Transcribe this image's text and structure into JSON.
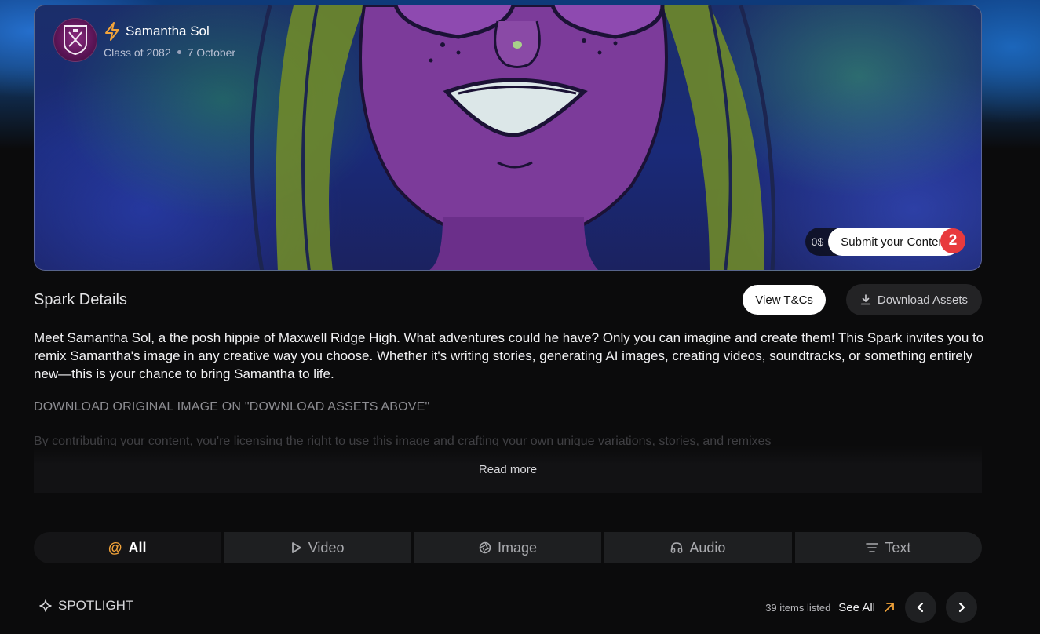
{
  "creator": {
    "name": "Samantha Sol",
    "class": "Class of 2082",
    "date": "7 October",
    "avatar_icon": "school-crest-icon"
  },
  "hero": {
    "price": "0$",
    "submit_label": "Submit your Content",
    "badge_count": "2"
  },
  "details": {
    "title": "Spark Details",
    "view_tcs_label": "View T&Cs",
    "download_assets_label": "Download Assets",
    "description": "Meet Samantha Sol, a the posh hippie of Maxwell Ridge High. What adventures could he have? Only you can imagine and create them! This Spark invites you to remix Samantha's image in any creative way you choose. Whether it's writing stories, generating AI images, creating videos, soundtracks, or something entirely new—this is your chance to bring Samantha to life.",
    "download_note": "DOWNLOAD ORIGINAL IMAGE ON \"DOWNLOAD ASSETS ABOVE\"",
    "faded_line": "By contributing your content, you're licensing the right to use this image and crafting your own unique variations, stories, and remixes",
    "read_more_label": "Read more"
  },
  "tabs": [
    {
      "label": "All",
      "icon": "at-icon"
    },
    {
      "label": "Video",
      "icon": "play-icon"
    },
    {
      "label": "Image",
      "icon": "aperture-icon"
    },
    {
      "label": "Audio",
      "icon": "headphones-icon"
    },
    {
      "label": "Text",
      "icon": "text-lines-icon"
    }
  ],
  "spotlight": {
    "label": "SPOTLIGHT",
    "items_count": "39 items listed",
    "see_all_label": "See All"
  },
  "colors": {
    "accent_orange": "#f2a33a",
    "badge_red": "#e83a3d",
    "background": "#0b0b0c"
  }
}
